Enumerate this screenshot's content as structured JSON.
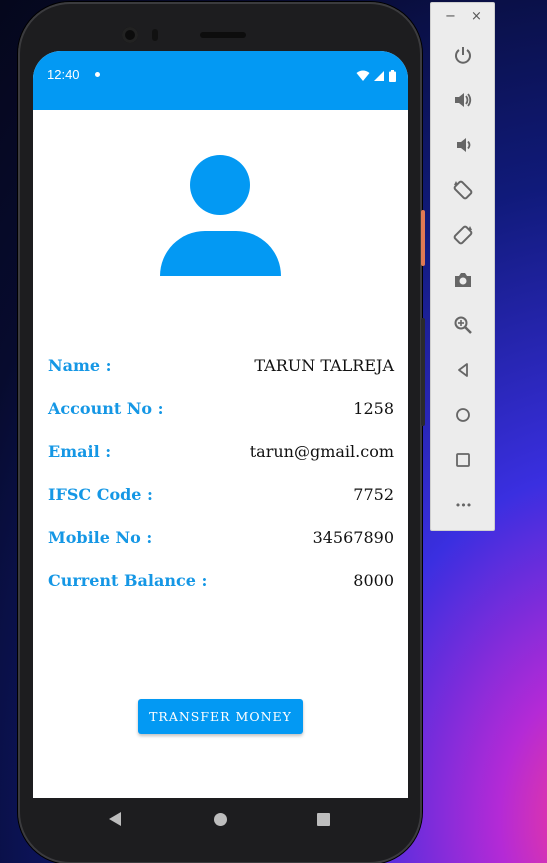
{
  "status_bar": {
    "time": "12:40"
  },
  "profile": {
    "rows": [
      {
        "label": "Name :",
        "value": "TARUN TALREJA"
      },
      {
        "label": "Account No :",
        "value": "1258"
      },
      {
        "label": "Email :",
        "value": "tarun@gmail.com"
      },
      {
        "label": "IFSC Code :",
        "value": "7752"
      },
      {
        "label": "Mobile No :",
        "value": "34567890"
      },
      {
        "label": "Current Balance :",
        "value": "8000"
      }
    ]
  },
  "actions": {
    "transfer_label": "TRANSFER MONEY"
  },
  "emulator": {
    "minimize_label": "−",
    "close_label": "×",
    "more_label": "•••",
    "buttons": [
      "power-icon",
      "volume-up-icon",
      "volume-down-icon",
      "rotate-left-icon",
      "rotate-right-icon",
      "camera-icon",
      "zoom-icon",
      "back-icon",
      "home-icon",
      "overview-icon",
      "more-icon"
    ]
  },
  "colors": {
    "accent": "#0399f3",
    "label": "#1597e5"
  }
}
